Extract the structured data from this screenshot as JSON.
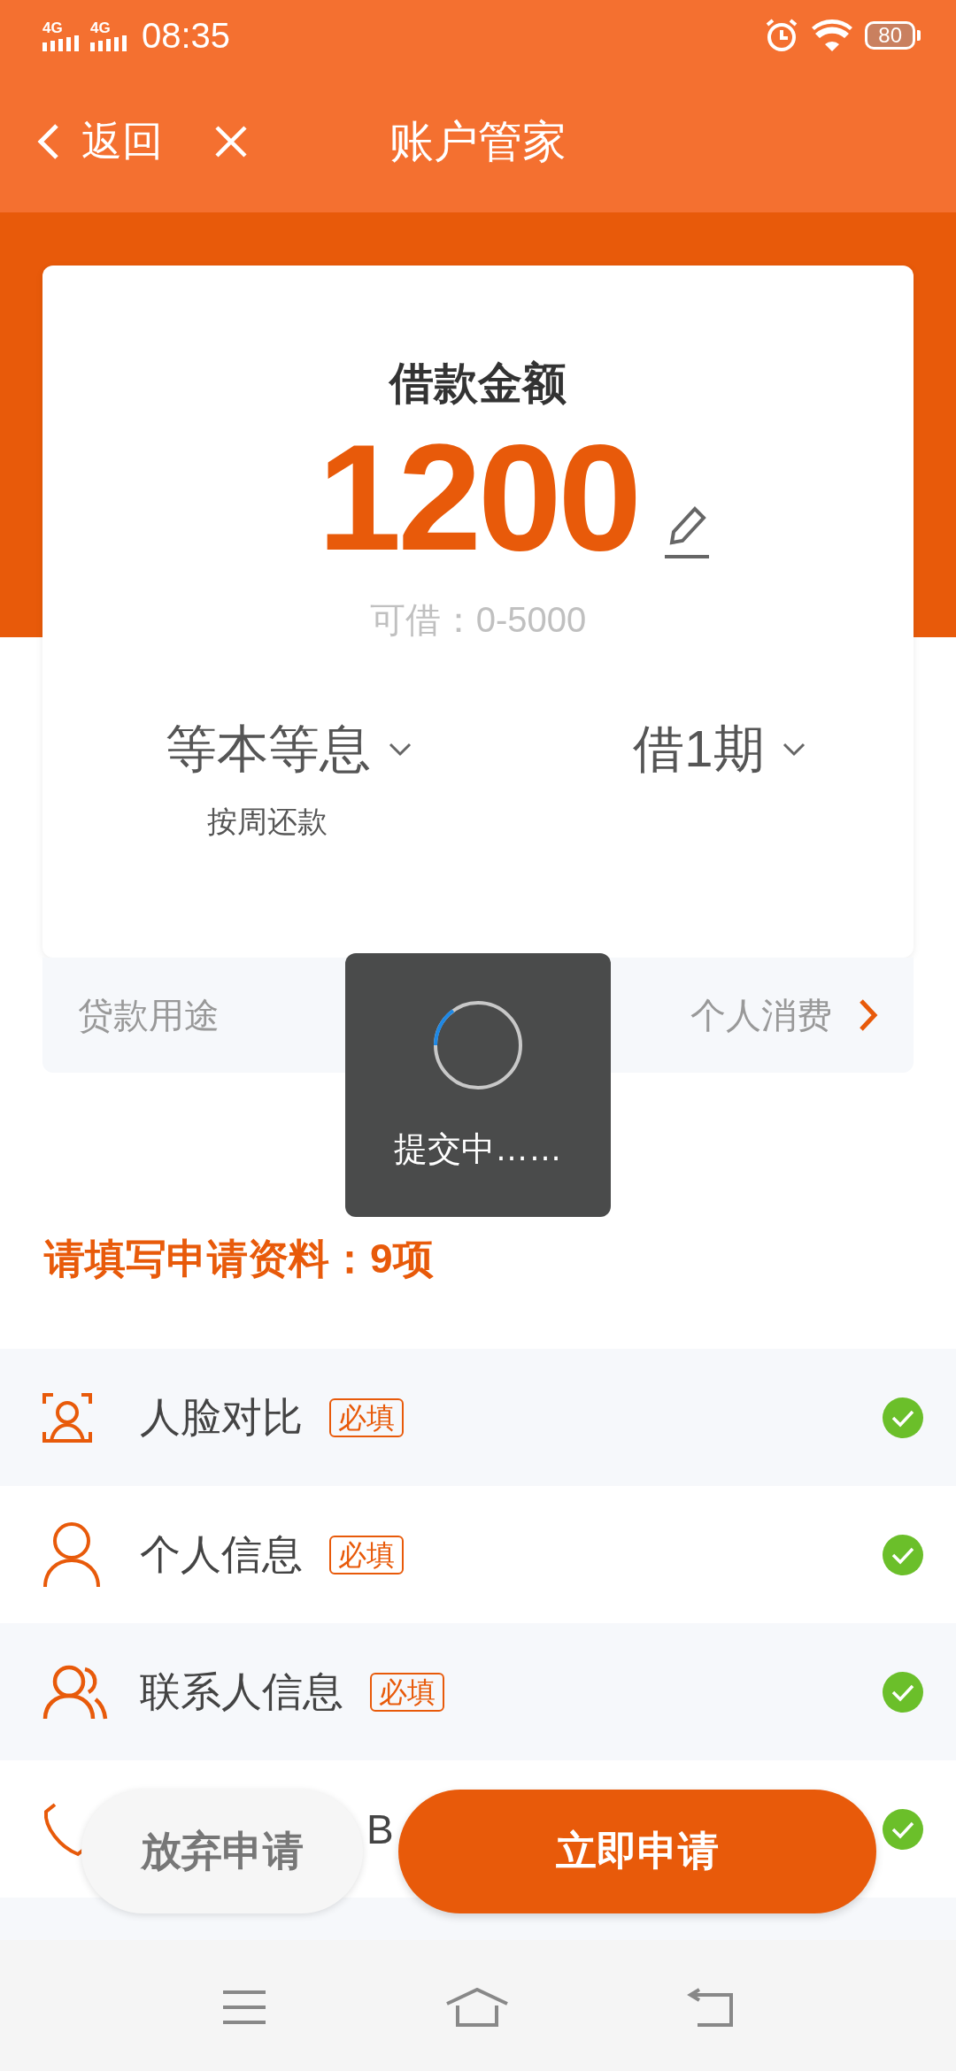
{
  "status_bar": {
    "networks": [
      "4G",
      "4G"
    ],
    "time": "08:35",
    "battery": "80"
  },
  "header": {
    "back": "返回",
    "title": "账户管家"
  },
  "loan": {
    "title": "借款金额",
    "amount": "1200",
    "range": "可借：0-5000",
    "repayment_type": "等本等息",
    "repayment_note": "按周还款",
    "term": "借1期"
  },
  "purpose": {
    "label": "贷款用途",
    "value": "个人消费"
  },
  "toast": {
    "text": "提交中……"
  },
  "section_title": "请填写申请资料：9项",
  "items": [
    {
      "kind": "face",
      "label": "人脸对比",
      "tag": "必填",
      "done": true
    },
    {
      "kind": "person",
      "label": "个人信息",
      "tag": "必填",
      "done": true
    },
    {
      "kind": "contacts",
      "label": "联系人信息",
      "tag": "必填",
      "done": true
    },
    {
      "kind": "phone",
      "label": "B",
      "done": true
    }
  ],
  "actions": [
    {
      "kind": "secondary",
      "label": "放弃申请"
    },
    {
      "kind": "primary",
      "label": "立即申请"
    }
  ]
}
